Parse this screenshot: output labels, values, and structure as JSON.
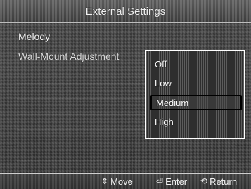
{
  "title": "External Settings",
  "menu": {
    "items": [
      {
        "label": "Melody"
      },
      {
        "label": "Wall-Mount Adjustment"
      }
    ]
  },
  "dropdown": {
    "options": [
      "Off",
      "Low",
      "Medium",
      "High"
    ],
    "selected": "Medium"
  },
  "bottom_bar": {
    "move": {
      "icon": "up-down-arrow-icon",
      "glyph": "⇕",
      "label": "Move"
    },
    "enter": {
      "icon": "enter-icon",
      "glyph": "⏎",
      "label": "Enter"
    },
    "return": {
      "icon": "return-icon",
      "glyph": "⟲",
      "label": "Return"
    }
  }
}
